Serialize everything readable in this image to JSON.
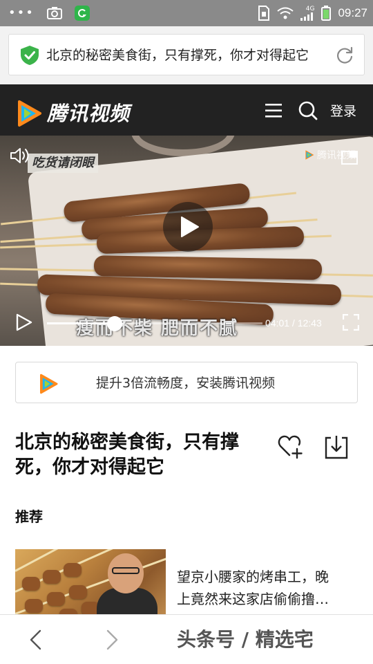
{
  "status_bar": {
    "time": "09:27",
    "network": "4G",
    "icons": [
      "notification-dots-icon",
      "camera-icon",
      "app-badge-icon",
      "sim-icon",
      "wifi-icon",
      "signal-icon",
      "battery-icon"
    ],
    "color": "#8a8a8a"
  },
  "address_bar": {
    "title": "北京的秘密美食街，只有撑死，你才对得起它",
    "secure_color": "#3bb34a"
  },
  "site_header": {
    "brand": "腾讯视频",
    "login_label": "登录",
    "background": "#222222"
  },
  "video": {
    "watermark": "腾讯视频",
    "ribbon": "吃货请闭眼",
    "caption": "瘦而不柴  肥而不腻",
    "current_time": "04:01",
    "total_time": "12:43",
    "progress": 0.315
  },
  "install_banner": {
    "text": "提升3倍流畅度，安装腾讯视频"
  },
  "article": {
    "title": "北京的秘密美食街，只有撑死，你才对得起它"
  },
  "recommend": {
    "heading": "推荐",
    "items": [
      {
        "title_line1": "望京小腰家的烤串工，晚",
        "title_line2": "上竟然来这家店偷偷撸…"
      }
    ]
  },
  "bottom_bar": {
    "watermark": "头条号 / 精选宅"
  }
}
